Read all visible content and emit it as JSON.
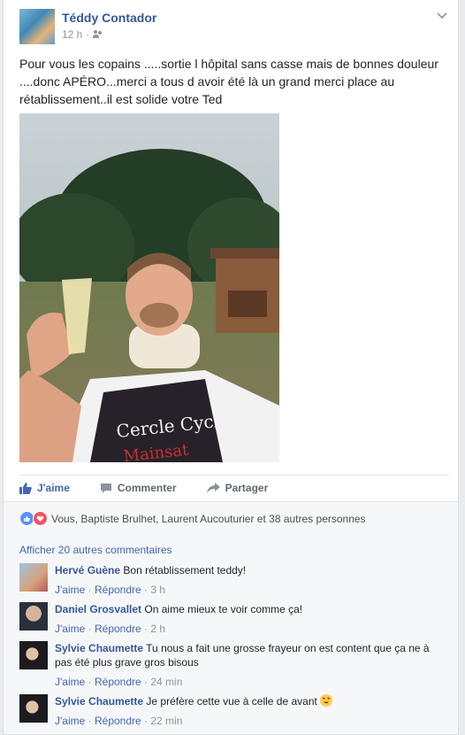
{
  "post": {
    "author": "Téddy Contador",
    "time": "12 h",
    "text": "Pour vous les copains .....sortie l hôpital sans casse mais de bonnes douleur ....donc APÉRO...merci a tous d avoir été là un grand merci place au rétablissement..il est solide votre Ted",
    "photo_jersey_text_1": "Cercle Cycliste",
    "photo_jersey_text_2": "Mainsat"
  },
  "actions": {
    "like": "J'aime",
    "comment": "Commenter",
    "share": "Partager"
  },
  "reactions": {
    "summary": "Vous, Baptiste Brulhet, Laurent Aucouturier et 38 autres personnes"
  },
  "comments": {
    "more": "Afficher 20 autres commentaires",
    "items": [
      {
        "name": "Hervé Guène",
        "text": "Bon rétablissement teddy!",
        "like": "J'aime",
        "reply": "Répondre",
        "time": "3 h"
      },
      {
        "name": "Daniel Grosvallet",
        "text": "On aime mieux te voir comme ça!",
        "like": "J'aime",
        "reply": "Répondre",
        "time": "2 h"
      },
      {
        "name": "Sylvie Chaumette",
        "text": "Tu nous a fait une grosse frayeur on est content que ça ne à pas été plus grave gros bisous",
        "like": "J'aime",
        "reply": "Répondre",
        "time": "24 min"
      },
      {
        "name": "Sylvie Chaumette",
        "text": "Je préfère cette vue à celle de avant",
        "like": "J'aime",
        "reply": "Répondre",
        "time": "22 min"
      }
    ]
  },
  "colors": {
    "link": "#365899",
    "action_blue": "#4267b2",
    "muted": "#90949c"
  }
}
